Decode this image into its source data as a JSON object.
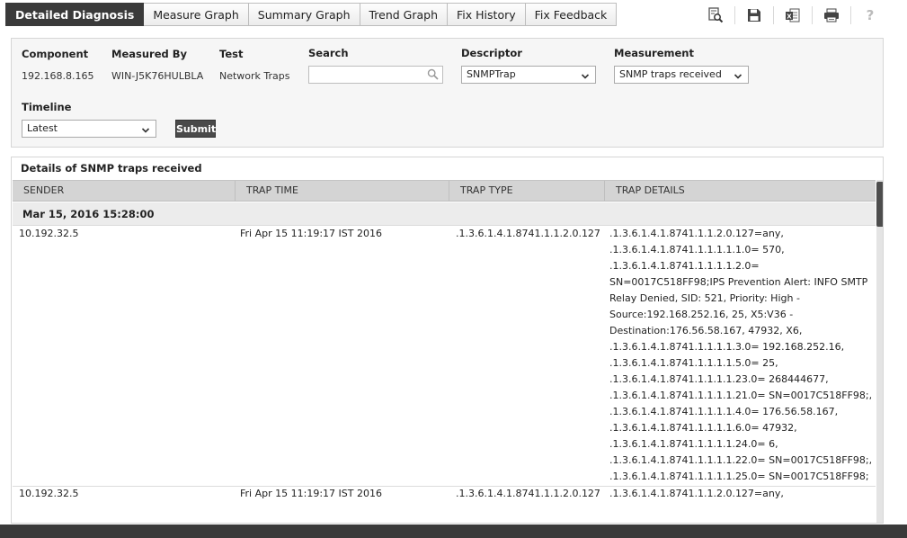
{
  "tabs": [
    {
      "label": "Detailed Diagnosis",
      "active": true
    },
    {
      "label": "Measure Graph",
      "active": false
    },
    {
      "label": "Summary Graph",
      "active": false
    },
    {
      "label": "Trend Graph",
      "active": false
    },
    {
      "label": "Fix History",
      "active": false
    },
    {
      "label": "Fix Feedback",
      "active": false
    }
  ],
  "toolbar": {
    "icons": [
      "search-doc-icon",
      "save-icon",
      "excel-export-icon",
      "print-icon",
      "help-icon"
    ],
    "help_label": "?"
  },
  "filter": {
    "component_label": "Component",
    "component_value": "192.168.8.165",
    "measured_by_label": "Measured By",
    "measured_by_value": "WIN-J5K76HULBLA",
    "test_label": "Test",
    "test_value": "Network Traps",
    "search_label": "Search",
    "search_value": "",
    "descriptor_label": "Descriptor",
    "descriptor_value": "SNMPTrap",
    "measurement_label": "Measurement",
    "measurement_value": "SNMP traps received",
    "timeline_label": "Timeline",
    "timeline_value": "Latest",
    "submit_label": "Submit"
  },
  "details": {
    "title": "Details of SNMP traps received",
    "columns": [
      "SENDER",
      "TRAP TIME",
      "TRAP TYPE",
      "TRAP DETAILS"
    ],
    "group_label": "Mar 15, 2016 15:28:00",
    "rows": [
      {
        "sender": "10.192.32.5",
        "trap_time": "Fri Apr 15 11:19:17 IST 2016",
        "trap_type": ".1.3.6.1.4.1.8741.1.1.2.0.127",
        "trap_details": [
          ".1.3.6.1.4.1.8741.1.1.2.0.127=any,",
          ".1.3.6.1.4.1.8741.1.1.1.1.1.0= 570,",
          ".1.3.6.1.4.1.8741.1.1.1.1.2.0=",
          "SN=0017C518FF98;IPS Prevention Alert: INFO SMTP",
          "Relay Denied, SID: 521, Priority: High -",
          "Source:192.168.252.16, 25, X5:V36 -",
          "Destination:176.56.58.167, 47932, X6,",
          ".1.3.6.1.4.1.8741.1.1.1.1.3.0= 192.168.252.16,",
          ".1.3.6.1.4.1.8741.1.1.1.1.5.0= 25,",
          ".1.3.6.1.4.1.8741.1.1.1.1.23.0= 268444677,",
          ".1.3.6.1.4.1.8741.1.1.1.1.21.0= SN=0017C518FF98;,",
          ".1.3.6.1.4.1.8741.1.1.1.1.4.0= 176.56.58.167,",
          ".1.3.6.1.4.1.8741.1.1.1.1.6.0= 47932,",
          ".1.3.6.1.4.1.8741.1.1.1.1.24.0= 6,",
          ".1.3.6.1.4.1.8741.1.1.1.1.22.0= SN=0017C518FF98;,",
          ".1.3.6.1.4.1.8741.1.1.1.1.25.0= SN=0017C518FF98;"
        ]
      },
      {
        "sender": "10.192.32.5",
        "trap_time": "Fri Apr 15 11:19:17 IST 2016",
        "trap_type": ".1.3.6.1.4.1.8741.1.1.2.0.127",
        "trap_details": [
          ".1.3.6.1.4.1.8741.1.1.2.0.127=any,"
        ]
      }
    ]
  }
}
